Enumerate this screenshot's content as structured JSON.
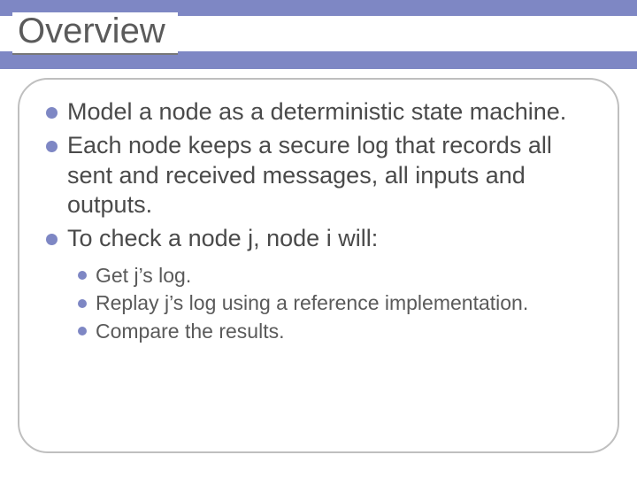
{
  "title": "Overview",
  "bullets": [
    {
      "text": "Model a node as a deterministic state machine."
    },
    {
      "text": "Each node keeps a secure log that records all sent and received messages, all inputs and outputs."
    },
    {
      "text": "To check a node j, node i will:"
    }
  ],
  "sub_bullets": [
    {
      "text": "Get j’s log."
    },
    {
      "text": "Replay j’s log using a reference implementation."
    },
    {
      "text": "Compare the results."
    }
  ]
}
